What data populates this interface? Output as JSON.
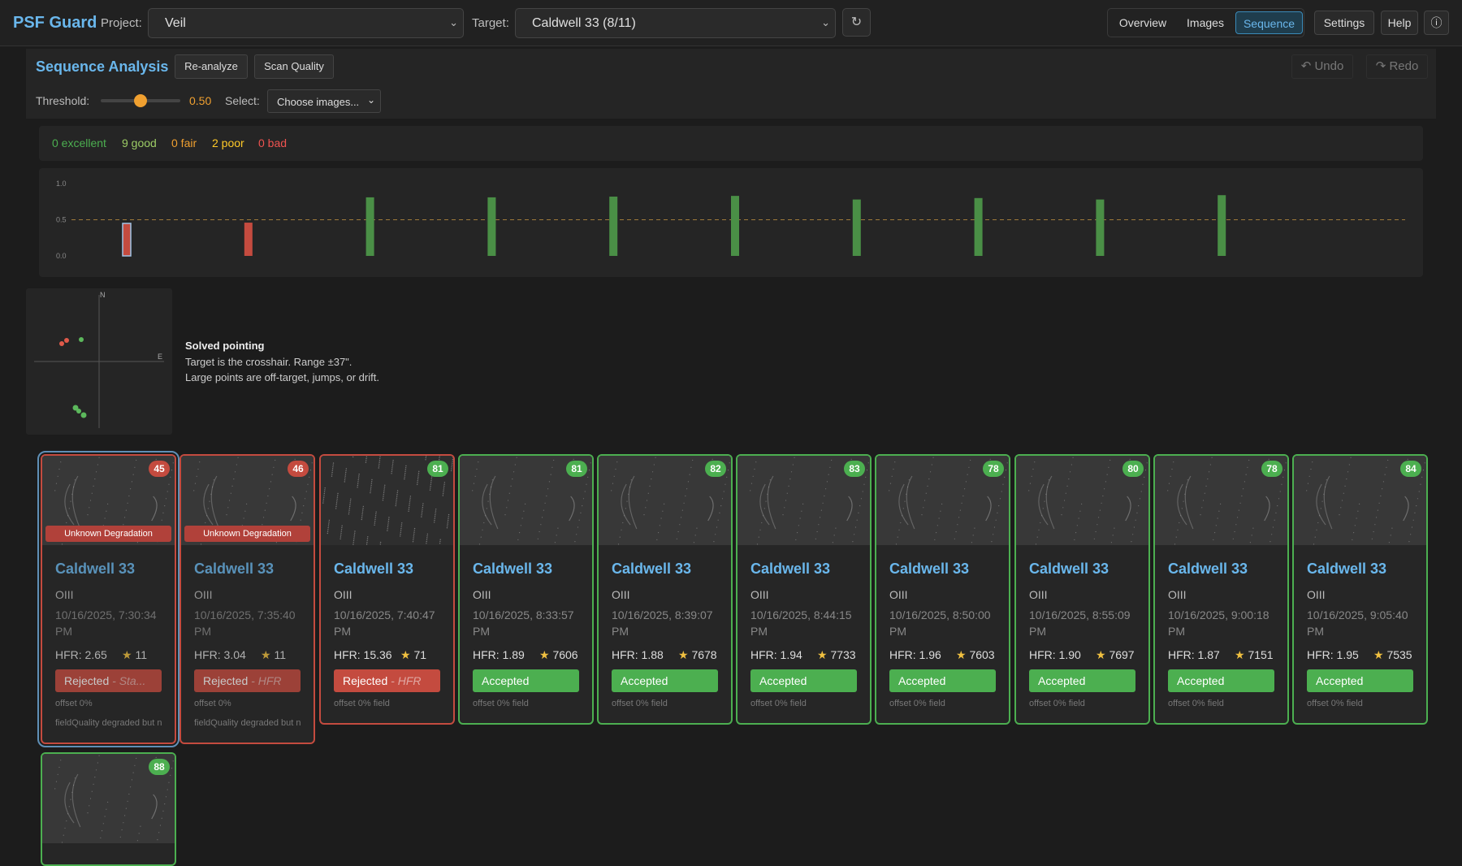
{
  "app": {
    "brand": "PSF Guard",
    "project_label": "Project:",
    "project_value": "Veil",
    "target_label": "Target:",
    "target_value": "Caldwell 33 (8/11)"
  },
  "nav": {
    "overview": "Overview",
    "images": "Images",
    "sequence": "Sequence",
    "settings": "Settings",
    "help": "Help"
  },
  "panel": {
    "title": "Sequence Analysis",
    "reanalyze": "Re-analyze",
    "scan": "Scan Quality",
    "undo": "Undo",
    "redo": "Redo",
    "threshold_label": "Threshold:",
    "threshold_value": "0.50",
    "select_label": "Select:",
    "select_value": "Choose images..."
  },
  "counts": {
    "excellent": "0 excellent",
    "good": "9 good",
    "fair": "0 fair",
    "poor": "2 poor",
    "bad": "0 bad"
  },
  "chart_data": {
    "type": "bar",
    "y_ticks": [
      "1.0",
      "0.5",
      "0.0"
    ],
    "ylim": [
      0,
      1
    ],
    "threshold": 0.5,
    "values": [
      0.45,
      0.46,
      0.81,
      0.81,
      0.82,
      0.83,
      0.78,
      0.8,
      0.78,
      0.84,
      0.88
    ],
    "status": [
      "rejected",
      "rejected",
      "good",
      "good",
      "good",
      "good",
      "good",
      "good",
      "good",
      "good",
      "good"
    ]
  },
  "sky": {
    "north": "N",
    "east": "E",
    "title": "Solved pointing",
    "line1": "Target is the crosshair. Range ±37\".",
    "line2": "Large points are off-target, jumps, or drift."
  },
  "cards": [
    {
      "score": "45",
      "title": "Caldwell 33",
      "filter": "OIII",
      "date": "10/16/2025, 7:30:34 PM",
      "hfr": "HFR: 2.65",
      "stars": "11",
      "status": "Rejected",
      "reason": " - Sta...",
      "degradation": "Unknown Degradation",
      "offset": "offset 0%",
      "note": "fieldQuality degraded but n"
    },
    {
      "score": "46",
      "title": "Caldwell 33",
      "filter": "OIII",
      "date": "10/16/2025, 7:35:40 PM",
      "hfr": "HFR: 3.04",
      "stars": "11",
      "status": "Rejected",
      "reason": " - HFR",
      "degradation": "Unknown Degradation",
      "offset": "offset 0%",
      "note": "fieldQuality degraded but n"
    },
    {
      "score": "81",
      "title": "Caldwell 33",
      "filter": "OIII",
      "date": "10/16/2025, 7:40:47 PM",
      "hfr": "HFR: 15.36",
      "stars": "71",
      "status": "Rejected",
      "reason": " - HFR",
      "offset": "offset 0% field"
    },
    {
      "score": "81",
      "title": "Caldwell 33",
      "filter": "OIII",
      "date": "10/16/2025, 8:33:57 PM",
      "hfr": "HFR: 1.89",
      "stars": "7606",
      "status": "Accepted",
      "offset": "offset 0% field"
    },
    {
      "score": "82",
      "title": "Caldwell 33",
      "filter": "OIII",
      "date": "10/16/2025, 8:39:07 PM",
      "hfr": "HFR: 1.88",
      "stars": "7678",
      "status": "Accepted",
      "offset": "offset 0% field"
    },
    {
      "score": "83",
      "title": "Caldwell 33",
      "filter": "OIII",
      "date": "10/16/2025, 8:44:15 PM",
      "hfr": "HFR: 1.94",
      "stars": "7733",
      "status": "Accepted",
      "offset": "offset 0% field"
    },
    {
      "score": "78",
      "title": "Caldwell 33",
      "filter": "OIII",
      "date": "10/16/2025, 8:50:00 PM",
      "hfr": "HFR: 1.96",
      "stars": "7603",
      "status": "Accepted",
      "offset": "offset 0% field"
    },
    {
      "score": "80",
      "title": "Caldwell 33",
      "filter": "OIII",
      "date": "10/16/2025, 8:55:09 PM",
      "hfr": "HFR: 1.90",
      "stars": "7697",
      "status": "Accepted",
      "offset": "offset 0% field"
    },
    {
      "score": "78",
      "title": "Caldwell 33",
      "filter": "OIII",
      "date": "10/16/2025, 9:00:18 PM",
      "hfr": "HFR: 1.87",
      "stars": "7151",
      "status": "Accepted",
      "offset": "offset 0% field"
    },
    {
      "score": "84",
      "title": "Caldwell 33",
      "filter": "OIII",
      "date": "10/16/2025, 9:05:40 PM",
      "hfr": "HFR: 1.95",
      "stars": "7535",
      "status": "Accepted",
      "offset": "offset 0% field"
    },
    {
      "score": "88"
    }
  ],
  "colors": {
    "accent": "#6ab7ec",
    "good": "#4caf50",
    "bad": "#c44b3f",
    "excellent": "#4caf50",
    "goodText": "#9ccc65",
    "fair": "#f0a030",
    "poor": "#ffca28",
    "badText": "#ef5350"
  }
}
